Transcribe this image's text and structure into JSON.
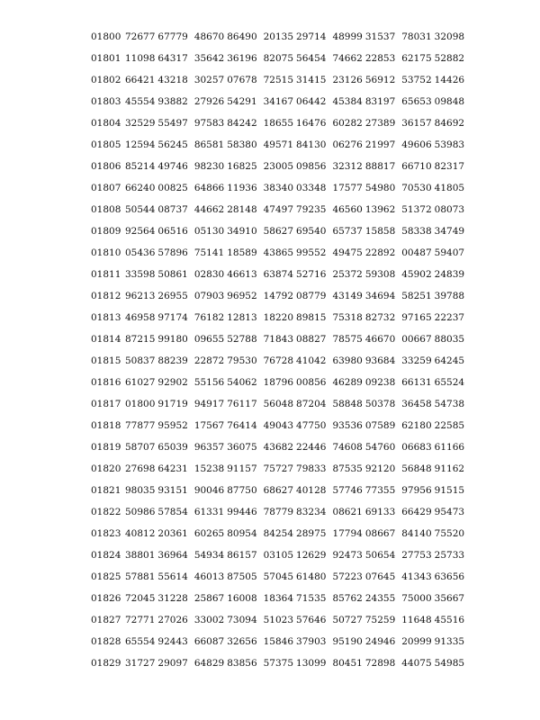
{
  "rows": [
    {
      "id": "01800",
      "groups": [
        [
          "72677",
          "67779"
        ],
        [
          "48670",
          "86490"
        ],
        [
          "20135",
          "29714"
        ],
        [
          "48999",
          "31537"
        ],
        [
          "78031",
          "32098"
        ]
      ]
    },
    {
      "id": "01801",
      "groups": [
        [
          "11098",
          "64317"
        ],
        [
          "35642",
          "36196"
        ],
        [
          "82075",
          "56454"
        ],
        [
          "74662",
          "22853"
        ],
        [
          "62175",
          "52882"
        ]
      ]
    },
    {
      "id": "01802",
      "groups": [
        [
          "66421",
          "43218"
        ],
        [
          "30257",
          "07678"
        ],
        [
          "72515",
          "31415"
        ],
        [
          "23126",
          "56912"
        ],
        [
          "53752",
          "14426"
        ]
      ]
    },
    {
      "id": "01803",
      "groups": [
        [
          "45554",
          "93882"
        ],
        [
          "27926",
          "54291"
        ],
        [
          "34167",
          "06442"
        ],
        [
          "45384",
          "83197"
        ],
        [
          "65653",
          "09848"
        ]
      ]
    },
    {
      "id": "01804",
      "groups": [
        [
          "32529",
          "55497"
        ],
        [
          "97583",
          "84242"
        ],
        [
          "18655",
          "16476"
        ],
        [
          "60282",
          "27389"
        ],
        [
          "36157",
          "84692"
        ]
      ]
    },
    {
      "id": "01805",
      "groups": [
        [
          "12594",
          "56245"
        ],
        [
          "86581",
          "58380"
        ],
        [
          "49571",
          "84130"
        ],
        [
          "06276",
          "21997"
        ],
        [
          "49606",
          "53983"
        ]
      ]
    },
    {
      "id": "01806",
      "groups": [
        [
          "85214",
          "49746"
        ],
        [
          "98230",
          "16825"
        ],
        [
          "23005",
          "09856"
        ],
        [
          "32312",
          "88817"
        ],
        [
          "66710",
          "82317"
        ]
      ]
    },
    {
      "id": "01807",
      "groups": [
        [
          "66240",
          "00825"
        ],
        [
          "64866",
          "11936"
        ],
        [
          "38340",
          "03348"
        ],
        [
          "17577",
          "54980"
        ],
        [
          "70530",
          "41805"
        ]
      ]
    },
    {
      "id": "01808",
      "groups": [
        [
          "50544",
          "08737"
        ],
        [
          "44662",
          "28148"
        ],
        [
          "47497",
          "79235"
        ],
        [
          "46560",
          "13962"
        ],
        [
          "51372",
          "08073"
        ]
      ]
    },
    {
      "id": "01809",
      "groups": [
        [
          "92564",
          "06516"
        ],
        [
          "05130",
          "34910"
        ],
        [
          "58627",
          "69540"
        ],
        [
          "65737",
          "15858"
        ],
        [
          "58338",
          "34749"
        ]
      ]
    },
    {
      "id": "01810",
      "groups": [
        [
          "05436",
          "57896"
        ],
        [
          "75141",
          "18589"
        ],
        [
          "43865",
          "99552"
        ],
        [
          "49475",
          "22892"
        ],
        [
          "00487",
          "59407"
        ]
      ]
    },
    {
      "id": "01811",
      "groups": [
        [
          "33598",
          "50861"
        ],
        [
          "02830",
          "46613"
        ],
        [
          "63874",
          "52716"
        ],
        [
          "25372",
          "59308"
        ],
        [
          "45902",
          "24839"
        ]
      ]
    },
    {
      "id": "01812",
      "groups": [
        [
          "96213",
          "26955"
        ],
        [
          "07903",
          "96952"
        ],
        [
          "14792",
          "08779"
        ],
        [
          "43149",
          "34694"
        ],
        [
          "58251",
          "39788"
        ]
      ]
    },
    {
      "id": "01813",
      "groups": [
        [
          "46958",
          "97174"
        ],
        [
          "76182",
          "12813"
        ],
        [
          "18220",
          "89815"
        ],
        [
          "75318",
          "82732"
        ],
        [
          "97165",
          "22237"
        ]
      ]
    },
    {
      "id": "01814",
      "groups": [
        [
          "87215",
          "99180"
        ],
        [
          "09655",
          "52788"
        ],
        [
          "71843",
          "08827"
        ],
        [
          "78575",
          "46670"
        ],
        [
          "00667",
          "88035"
        ]
      ]
    },
    {
      "id": "01815",
      "groups": [
        [
          "50837",
          "88239"
        ],
        [
          "22872",
          "79530"
        ],
        [
          "76728",
          "41042"
        ],
        [
          "63980",
          "93684"
        ],
        [
          "33259",
          "64245"
        ]
      ]
    },
    {
      "id": "01816",
      "groups": [
        [
          "61027",
          "92902"
        ],
        [
          "55156",
          "54062"
        ],
        [
          "18796",
          "00856"
        ],
        [
          "46289",
          "09238"
        ],
        [
          "66131",
          "65524"
        ]
      ]
    },
    {
      "id": "01817",
      "groups": [
        [
          "01800",
          "91719"
        ],
        [
          "94917",
          "76117"
        ],
        [
          "56048",
          "87204"
        ],
        [
          "58848",
          "50378"
        ],
        [
          "36458",
          "54738"
        ]
      ]
    },
    {
      "id": "01818",
      "groups": [
        [
          "77877",
          "95952"
        ],
        [
          "17567",
          "76414"
        ],
        [
          "49043",
          "47750"
        ],
        [
          "93536",
          "07589"
        ],
        [
          "62180",
          "22585"
        ]
      ]
    },
    {
      "id": "01819",
      "groups": [
        [
          "58707",
          "65039"
        ],
        [
          "96357",
          "36075"
        ],
        [
          "43682",
          "22446"
        ],
        [
          "74608",
          "54760"
        ],
        [
          "06683",
          "61166"
        ]
      ]
    },
    {
      "id": "01820",
      "groups": [
        [
          "27698",
          "64231"
        ],
        [
          "15238",
          "91157"
        ],
        [
          "75727",
          "79833"
        ],
        [
          "87535",
          "92120"
        ],
        [
          "56848",
          "91162"
        ]
      ]
    },
    {
      "id": "01821",
      "groups": [
        [
          "98035",
          "93151"
        ],
        [
          "90046",
          "87750"
        ],
        [
          "68627",
          "40128"
        ],
        [
          "57746",
          "77355"
        ],
        [
          "97956",
          "91515"
        ]
      ]
    },
    {
      "id": "01822",
      "groups": [
        [
          "50986",
          "57854"
        ],
        [
          "61331",
          "99446"
        ],
        [
          "78779",
          "83234"
        ],
        [
          "08621",
          "69133"
        ],
        [
          "66429",
          "95473"
        ]
      ]
    },
    {
      "id": "01823",
      "groups": [
        [
          "40812",
          "20361"
        ],
        [
          "60265",
          "80954"
        ],
        [
          "84254",
          "28975"
        ],
        [
          "17794",
          "08667"
        ],
        [
          "84140",
          "75520"
        ]
      ]
    },
    {
      "id": "01824",
      "groups": [
        [
          "38801",
          "36964"
        ],
        [
          "54934",
          "86157"
        ],
        [
          "03105",
          "12629"
        ],
        [
          "92473",
          "50654"
        ],
        [
          "27753",
          "25733"
        ]
      ]
    },
    {
      "id": "01825",
      "groups": [
        [
          "57881",
          "55614"
        ],
        [
          "46013",
          "87505"
        ],
        [
          "57045",
          "61480"
        ],
        [
          "57223",
          "07645"
        ],
        [
          "41343",
          "63656"
        ]
      ]
    },
    {
      "id": "01826",
      "groups": [
        [
          "72045",
          "31228"
        ],
        [
          "25867",
          "16008"
        ],
        [
          "18364",
          "71535"
        ],
        [
          "85762",
          "24355"
        ],
        [
          "75000",
          "35667"
        ]
      ]
    },
    {
      "id": "01827",
      "groups": [
        [
          "72771",
          "27026"
        ],
        [
          "33002",
          "73094"
        ],
        [
          "51023",
          "57646"
        ],
        [
          "50727",
          "75259"
        ],
        [
          "11648",
          "45516"
        ]
      ]
    },
    {
      "id": "01828",
      "groups": [
        [
          "65554",
          "92443"
        ],
        [
          "66087",
          "32656"
        ],
        [
          "15846",
          "37903"
        ],
        [
          "95190",
          "24946"
        ],
        [
          "20999",
          "91335"
        ]
      ]
    },
    {
      "id": "01829",
      "groups": [
        [
          "31727",
          "29097"
        ],
        [
          "64829",
          "83856"
        ],
        [
          "57375",
          "13099"
        ],
        [
          "80451",
          "72898"
        ],
        [
          "44075",
          "54985"
        ]
      ]
    }
  ]
}
